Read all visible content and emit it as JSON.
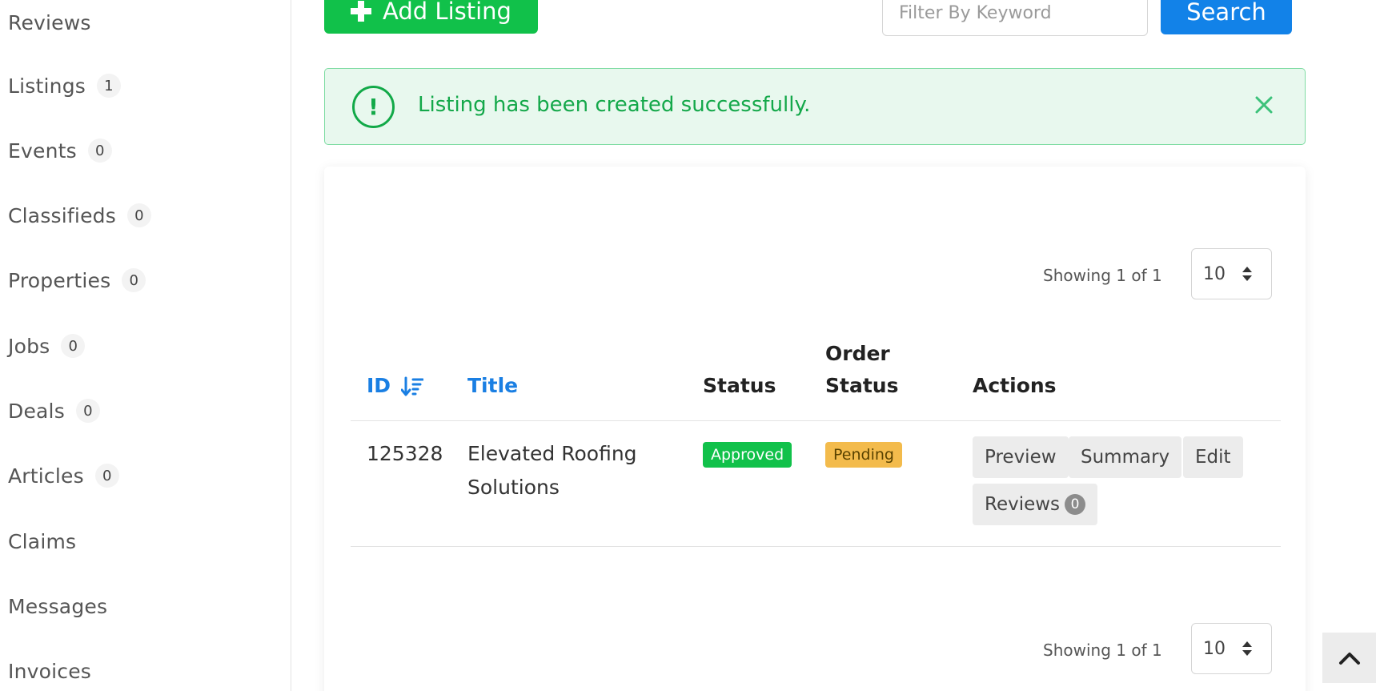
{
  "sidebar": {
    "items": [
      {
        "label": "Reviews",
        "count": ""
      },
      {
        "label": "Listings",
        "count": "1"
      },
      {
        "label": "Events",
        "count": "0"
      },
      {
        "label": "Classifieds",
        "count": "0"
      },
      {
        "label": "Properties",
        "count": "0"
      },
      {
        "label": "Jobs",
        "count": "0"
      },
      {
        "label": "Deals",
        "count": "0"
      },
      {
        "label": "Articles",
        "count": "0"
      },
      {
        "label": "Claims",
        "count": ""
      },
      {
        "label": "Messages",
        "count": ""
      },
      {
        "label": "Invoices",
        "count": ""
      }
    ]
  },
  "toolbar": {
    "add_label": "Add Listing",
    "filter_placeholder": "Filter By Keyword",
    "search_label": "Search"
  },
  "alert": {
    "message": "Listing has been created successfully."
  },
  "pagination": {
    "showing_text": "Showing 1 of 1",
    "per_page": "10"
  },
  "table": {
    "headers": {
      "id": "ID",
      "title": "Title",
      "status": "Status",
      "order_status_line1": "Order",
      "order_status_line2": "Status",
      "actions": "Actions"
    },
    "rows": [
      {
        "id": "125328",
        "title_line1": "Elevated Roofing",
        "title_line2": "Solutions",
        "status": "Approved",
        "order_status": "Pending",
        "actions": {
          "preview": "Preview",
          "summary": "Summary",
          "edit": "Edit",
          "reviews": "Reviews",
          "reviews_count": "0"
        }
      }
    ]
  },
  "colors": {
    "primary_green": "#11c14a",
    "primary_blue": "#1282e8",
    "alert_text": "#14a84a",
    "pending_badge": "#f3bb4c"
  },
  "icons": {
    "alert": "exclamation-circle-icon",
    "close": "close-icon",
    "sort": "sort-descending-icon",
    "scroll_top": "chevron-up-icon",
    "add": "plus-icon"
  }
}
